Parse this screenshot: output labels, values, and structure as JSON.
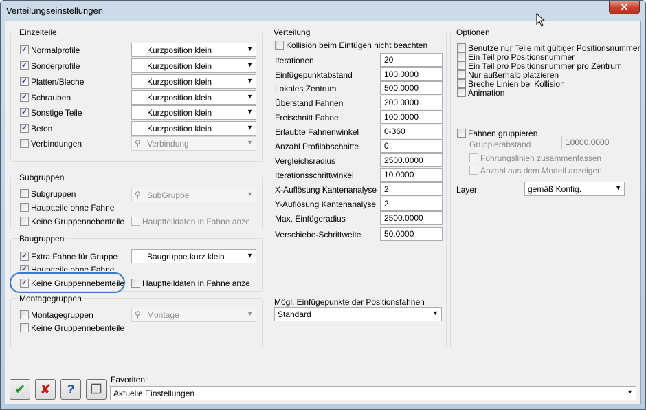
{
  "window": {
    "title": "Verteilungseinstellungen",
    "close_label": "✕"
  },
  "einzelteile": {
    "title": "Einzelteile",
    "rows": [
      {
        "label": "Normalprofile",
        "checked": "✓",
        "combo": "Kurzposition klein"
      },
      {
        "label": "Sonderprofile",
        "checked": "✓",
        "combo": "Kurzposition klein"
      },
      {
        "label": "Platten/Bleche",
        "checked": "✓",
        "combo": "Kurzposition klein"
      },
      {
        "label": "Schrauben",
        "checked": "✓",
        "combo": "Kurzposition klein"
      },
      {
        "label": "Sonstige Teile",
        "checked": "✓",
        "combo": "Kurzposition klein"
      },
      {
        "label": "Beton",
        "checked": "✓",
        "combo": "Kurzposition klein"
      },
      {
        "label": "Verbindungen",
        "checked": "",
        "combo": "Verbindung"
      }
    ]
  },
  "subgruppen": {
    "title": "Subgruppen",
    "cb1": "Subgruppen",
    "combo": "SubGruppe",
    "cb2": "Hauptteile ohne Fahne",
    "cb3": "Keine Gruppennebenteile",
    "cb4": "Hauptteildaten in Fahne anzeigen"
  },
  "baugruppen": {
    "title": "Baugruppen",
    "cb1": "Extra Fahne für Gruppe",
    "combo": "Baugruppe kurz klein",
    "cb2": "Hauptteile ohne Fahne",
    "cb3": "Keine Gruppennebenteile",
    "cb4": "Hauptteildaten in Fahne anzeigen"
  },
  "montagegruppen": {
    "title": "Montagegruppen",
    "cb1": "Montagegruppen",
    "combo": "Montage",
    "cb2": "Keine Gruppennebenteile"
  },
  "verteilung": {
    "title": "Verteilung",
    "kollision": "Kollision beim Einfügen nicht beachten",
    "fields": [
      {
        "label": "Iterationen",
        "value": "20"
      },
      {
        "label": "Einfügepunktabstand",
        "value": "100.0000"
      },
      {
        "label": "Lokales Zentrum",
        "value": "500.0000"
      },
      {
        "label": "Überstand Fahnen",
        "value": "200.0000"
      },
      {
        "label": "Freischnitt Fahne",
        "value": "100.0000"
      },
      {
        "label": "Erlaubte Fahnenwinkel",
        "value": "0-360"
      },
      {
        "label": "Anzahl Profilabschnitte",
        "value": "0"
      },
      {
        "label": "Vergleichsradius",
        "value": "2500.0000"
      },
      {
        "label": "Iterationsschrittwinkel",
        "value": "10.0000"
      },
      {
        "label": "X-Auflösung Kantenanalyse",
        "value": "2"
      },
      {
        "label": "Y-Auflösung Kantenanalyse",
        "value": "2"
      },
      {
        "label": "Max. Einfügeradius",
        "value": "2500.0000"
      },
      {
        "label": "Verschiebe-Schrittweite",
        "value": "50.0000"
      }
    ],
    "moegl_label": "Mögl. Einfügepunkte der Positionsfahnen",
    "moegl_value": "Standard"
  },
  "optionen": {
    "title": "Optionen",
    "checks": [
      "Benutze nur Teile mit gültiger Positionsnummer",
      "Ein Teil pro Positionsnummer",
      "Ein Teil pro Positionsnummer pro Zentrum",
      "Nur außerhalb platzieren",
      "Breche Linien bei Kollision",
      "Animation"
    ],
    "fahnen": "Fahnen gruppieren",
    "abstand_label": "Gruppierabstand",
    "abstand_value": "10000.0000",
    "fuehrung": "Führungslinien zusammenfassen",
    "anzahl": "Anzahl aus dem Modell anzeigen",
    "layer_label": "Layer",
    "layer_value": "gemäß Konfig."
  },
  "footer": {
    "favoriten_label": "Favoriten:",
    "favoriten_value": "Aktuelle Einstellungen"
  },
  "colors": {
    "ok": "#2e9a2e",
    "cancel": "#c0201c",
    "help": "#1c4fa8",
    "highlight": "#3b78c8"
  }
}
